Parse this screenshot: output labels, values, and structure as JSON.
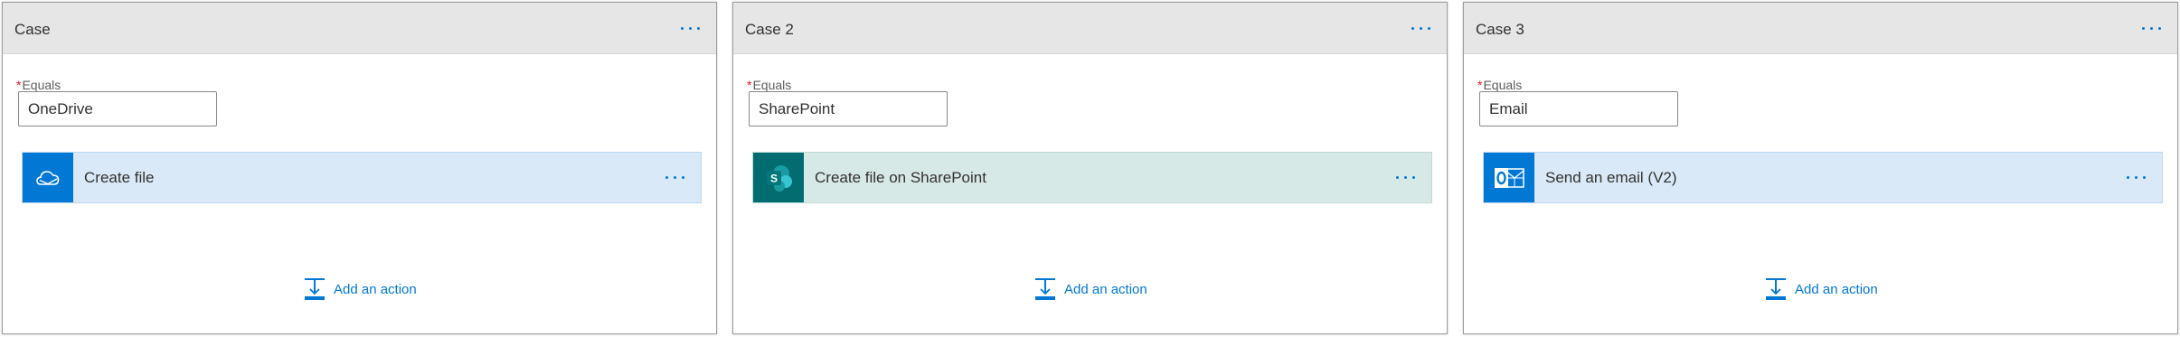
{
  "colors": {
    "accent": "#0078d4",
    "header_bg": "#e6e6e6",
    "onedrive_card": "#d9e9f7",
    "sharepoint_card": "#d7e9e6",
    "sharepoint_icon": "#036c70",
    "required": "#e81123"
  },
  "cases": [
    {
      "title": "Case",
      "equals_label": "Equals",
      "required_mark": "*",
      "equals_value": "OneDrive",
      "action": {
        "title": "Create file",
        "icon": "onedrive-icon"
      },
      "add_action_label": "Add an action"
    },
    {
      "title": "Case 2",
      "equals_label": "Equals",
      "required_mark": "*",
      "equals_value": "SharePoint",
      "action": {
        "title": "Create file on SharePoint",
        "icon": "sharepoint-icon",
        "icon_letter": "S"
      },
      "add_action_label": "Add an action"
    },
    {
      "title": "Case 3",
      "equals_label": "Equals",
      "required_mark": "*",
      "equals_value": "Email",
      "action": {
        "title": "Send an email (V2)",
        "icon": "outlook-icon"
      },
      "add_action_label": "Add an action"
    }
  ]
}
